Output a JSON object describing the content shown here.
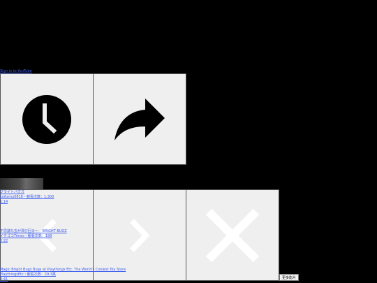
{
  "top_link": "Sign in to YouTube",
  "overlay": {
    "watch_later_icon": "clock-icon",
    "share_icon": "share-arrow-icon",
    "prev_icon": "chevron-left-icon",
    "next_icon": "chevron-right-icon",
    "close_icon": "close-x-icon"
  },
  "videos": [
    {
      "title": "ブライトバグズ",
      "meta": "koitamu0816・観看次数：1,300",
      "duration": "1:14"
    },
    {
      "title": "不思議な虫が飛び回る〜 _ BRIGHT BUGZ",
      "meta": "イチゴコTimes・観看次数：199",
      "duration": "0:22"
    },
    {
      "title": "Magic Bright Bugz Bugs at Playthings Etc. The World's Coolest Toy Store",
      "meta": "PlaythingsEtc・観看次数：29.3萬",
      "duration": "2:41"
    }
  ],
  "more_button": "更多影片"
}
